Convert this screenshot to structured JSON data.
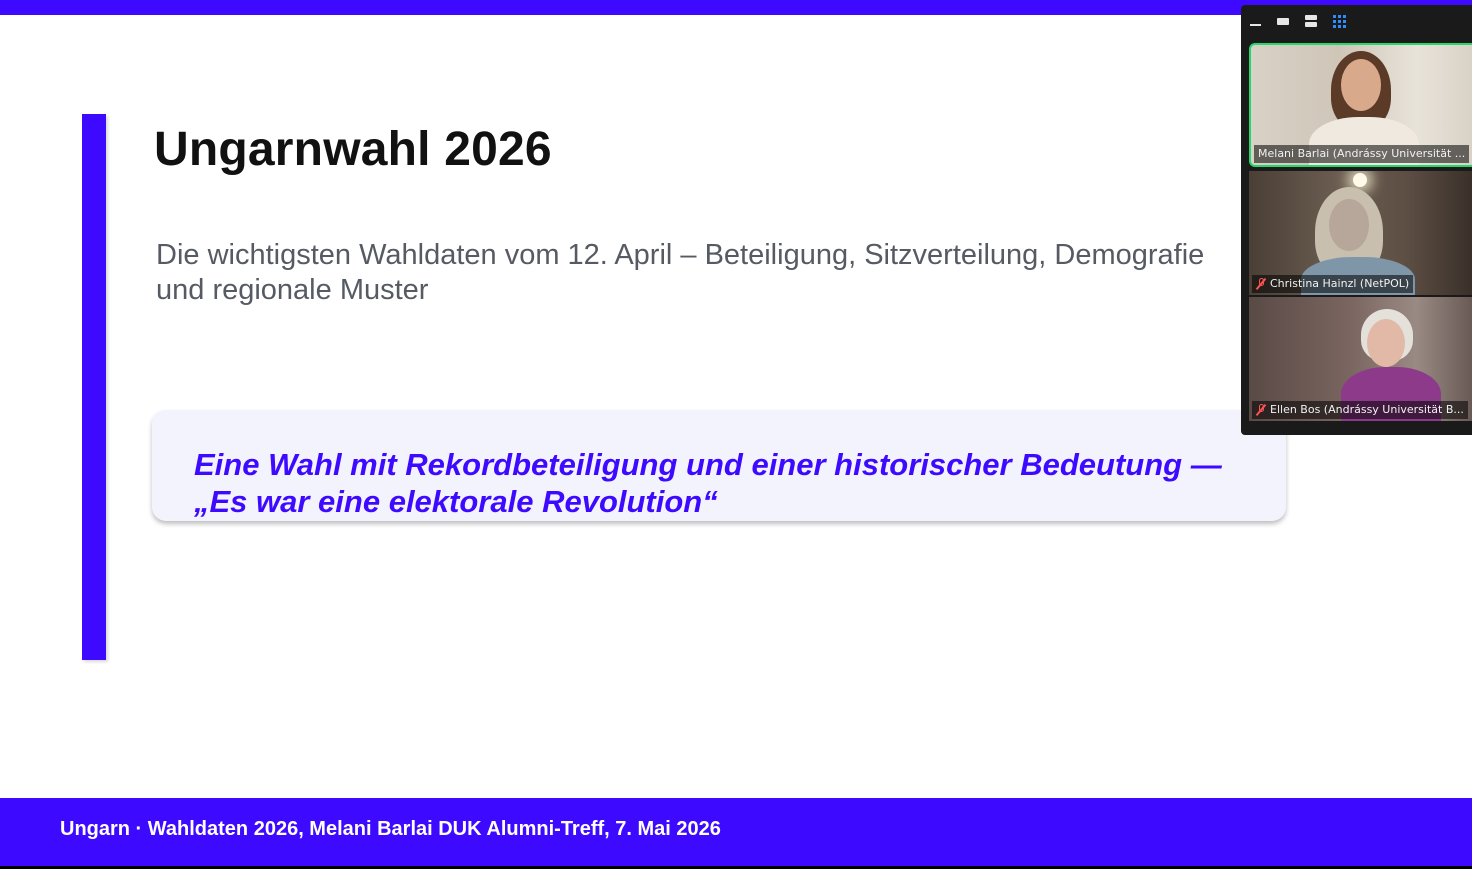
{
  "slide": {
    "title": "Ungarnwahl 2026",
    "subtitle": "Die wichtigsten Wahldaten vom 12. April – Beteiligung, Sitzverteilung, Demografie und regionale Muster",
    "quote": "Eine Wahl mit Rekordbeteiligung und einer historischer Bedeutung — „Es war eine elektorale Revolution“",
    "footer": "Ungarn · Wahldaten 2026, Melani Barlai DUK Alumni-Treff, 7. Mai 2026",
    "colors": {
      "accent": "#3d0aff",
      "quote_bg": "#f3f3fd",
      "subtitle": "#555a63"
    }
  },
  "video_panel": {
    "toolbar": [
      {
        "icon": "minimize-icon"
      },
      {
        "icon": "active-speaker-view-icon"
      },
      {
        "icon": "side-by-side-view-icon"
      },
      {
        "icon": "gallery-view-icon"
      }
    ],
    "participants": [
      {
        "name": "Melani Barlai (Andrássy Universität ...",
        "muted": false,
        "active_speaker": true
      },
      {
        "name": "Christina Hainzl (NetPOL)",
        "muted": true,
        "active_speaker": false
      },
      {
        "name": "Ellen Bos (Andrássy Universität B...",
        "muted": true,
        "active_speaker": false
      }
    ],
    "colors": {
      "active_border": "#23d96b",
      "muted_icon": "#ff5252",
      "gallery_icon": "#2d8cff"
    }
  }
}
